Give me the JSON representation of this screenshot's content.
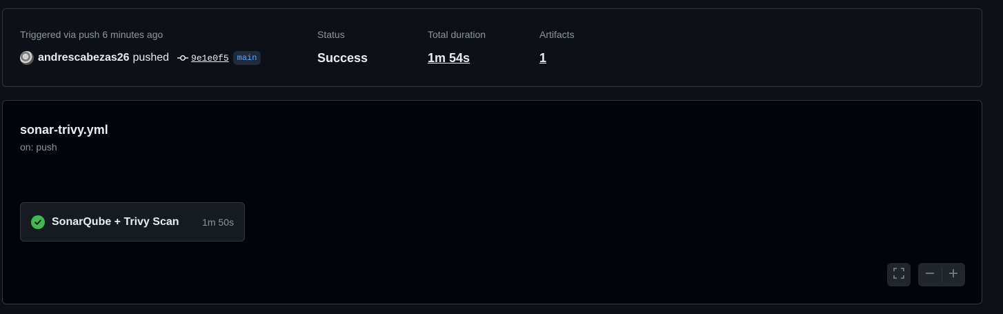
{
  "summary": {
    "trigger_text": "Triggered via push 6 minutes ago",
    "actor": "andrescabezas26",
    "action": "pushed",
    "commit_sha": "9e1e0f5",
    "branch": "main",
    "status_label": "Status",
    "status_value": "Success",
    "duration_label": "Total duration",
    "duration_value": "1m 54s",
    "artifacts_label": "Artifacts",
    "artifacts_value": "1"
  },
  "workflow": {
    "name": "sonar-trivy.yml",
    "trigger": "on: push",
    "jobs": [
      {
        "name": "SonarQube + Trivy Scan",
        "duration": "1m 50s",
        "status": "success",
        "status_color": "#3fb950"
      }
    ]
  },
  "controls": {
    "fullscreen_icon": "fullscreen-icon",
    "zoom_out_icon": "minus-icon",
    "zoom_in_icon": "plus-icon"
  },
  "colors": {
    "background": "#0d1117",
    "graph_background": "#010409",
    "border": "#30363d",
    "success": "#3fb950",
    "accent": "#58a6ff"
  }
}
